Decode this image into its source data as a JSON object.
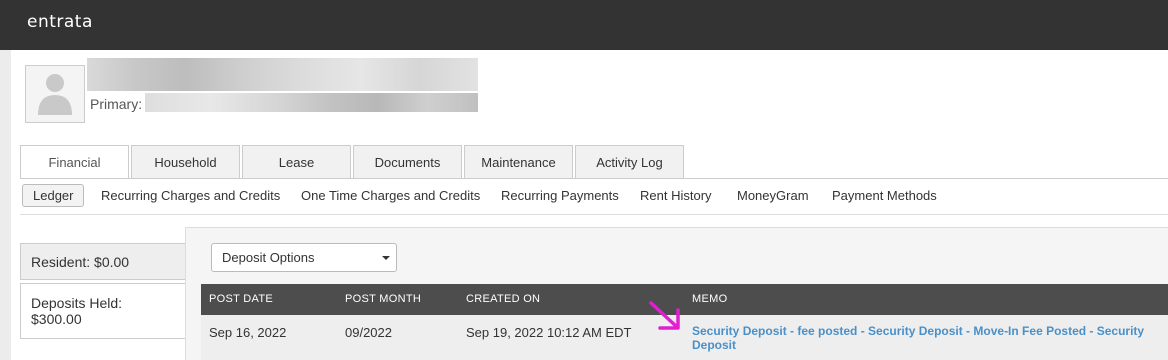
{
  "header": {
    "logo": "entrata"
  },
  "profile": {
    "primary_label": "Primary:"
  },
  "tabs": [
    "Financial",
    "Household",
    "Lease",
    "Documents",
    "Maintenance",
    "Activity Log"
  ],
  "subnav": [
    "Ledger",
    "Recurring Charges and Credits",
    "One Time Charges and Credits",
    "Recurring Payments",
    "Rent History",
    "MoneyGram",
    "Payment Methods"
  ],
  "balances": {
    "resident": "Resident: $0.00",
    "deposits_line1": "Deposits Held:",
    "deposits_line2": "$300.00"
  },
  "deposit_select": {
    "value": "Deposit Options"
  },
  "table": {
    "columns": [
      "POST DATE",
      "POST MONTH",
      "CREATED ON",
      "MEMO"
    ],
    "rows": [
      {
        "post_date": "Sep 16, 2022",
        "post_month": "09/2022",
        "created_on": "Sep 19, 2022 10:12 AM EDT",
        "memo": "Security Deposit - fee posted - Security Deposit - Move-In Fee Posted - Security Deposit"
      }
    ]
  },
  "colors": {
    "topbar": "#333333",
    "table_header": "#4d4d4d",
    "memo_link": "#4a90c8",
    "annotation_arrow": "#e020d0"
  }
}
